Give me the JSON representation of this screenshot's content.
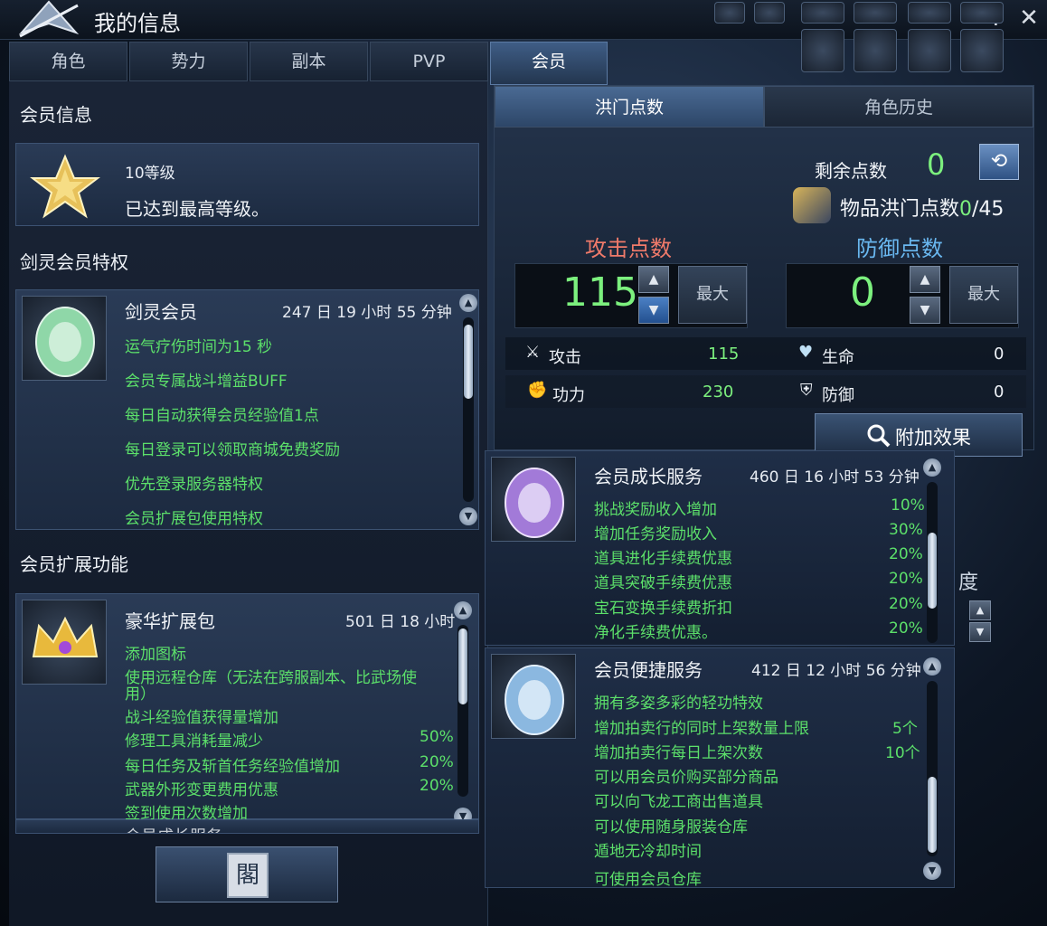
{
  "window": {
    "title": "我的信息",
    "help_icon": "?",
    "close_icon": "✕"
  },
  "tabs": [
    {
      "label": "角色"
    },
    {
      "label": "势力"
    },
    {
      "label": "副本"
    },
    {
      "label": "PVP"
    },
    {
      "label": "会员",
      "active": true
    }
  ],
  "membership": {
    "section_title": "会员信息",
    "level": "10等级",
    "level_status": "已达到最高等级。"
  },
  "privileges": {
    "section_title": "剑灵会员特权",
    "name": "剑灵会员",
    "duration": "247 日 19 小时 55 分钟",
    "items": [
      "运气疗伤时间为15 秒",
      "会员专属战斗增益BUFF",
      "每日自动获得会员经验值1点",
      "每日登录可以领取商城免费奖励",
      "优先登录服务器特权",
      "会员扩展包使用特权"
    ]
  },
  "extensions": {
    "section_title": "会员扩展功能",
    "name": "豪华扩展包",
    "duration": "501 日 18 小时",
    "items": [
      {
        "label": "添加图标",
        "value": ""
      },
      {
        "label": "使用远程仓库（无法在跨服副本、比武场使",
        "value": ""
      },
      {
        "label": "用）",
        "value": ""
      },
      {
        "label": "战斗经验值获得量增加",
        "value": ""
      },
      {
        "label": "修理工具消耗量减少",
        "value": "50%"
      },
      {
        "label": "每日任务及斩首任务经验值增加",
        "value": "20%"
      },
      {
        "label": "武器外形变更费用优惠",
        "value": "20%"
      },
      {
        "label": "签到使用次数增加",
        "value": ""
      }
    ],
    "partial_next": "会员成长服务"
  },
  "points": {
    "subtab_active": "洪门点数",
    "subtab_inactive": "角色历史",
    "remaining_label": "剩余点数",
    "remaining_value": "0",
    "item_points_label": "物品洪门点数",
    "item_points_current": "0",
    "item_points_max": "/45",
    "attack_title": "攻击点数",
    "defense_title": "防御点数",
    "attack_value": "115",
    "defense_value": "0",
    "max_label": "最大",
    "stats": {
      "attack_label": "攻击",
      "attack_value": "115",
      "power_label": "功力",
      "power_value": "230",
      "hp_label": "生命",
      "hp_value": "0",
      "def_label": "防御",
      "def_value": "0"
    },
    "extra_effect_label": "附加效果"
  },
  "growth_service": {
    "name": "会员成长服务",
    "duration": "460 日 16 小时 53 分钟",
    "items": [
      {
        "label": "挑战奖励收入增加",
        "value": "10%"
      },
      {
        "label": "增加任务奖励收入",
        "value": "30%"
      },
      {
        "label": "道具进化手续费优惠",
        "value": "20%"
      },
      {
        "label": "道具突破手续费优惠",
        "value": "20%"
      },
      {
        "label": "宝石变换手续费折扣",
        "value": "20%"
      },
      {
        "label": "净化手续费优惠。",
        "value": "20%"
      }
    ]
  },
  "convenience_service": {
    "name": "会员便捷服务",
    "duration": "412 日 12 小时 56 分钟",
    "items": [
      {
        "label": "拥有多姿多彩的轻功特效",
        "value": ""
      },
      {
        "label": "增加拍卖行的同时上架数量上限",
        "value": "5个"
      },
      {
        "label": "增加拍卖行每日上架次数",
        "value": "10个"
      },
      {
        "label": "可以用会员价购买部分商品",
        "value": ""
      },
      {
        "label": "可以向飞龙工商出售道具",
        "value": ""
      },
      {
        "label": "可以使用随身服装仓库",
        "value": ""
      },
      {
        "label": "遁地无冷却时间",
        "value": ""
      },
      {
        "label": "可使用会员仓库",
        "value": ""
      }
    ]
  },
  "background_fragment": "度",
  "icon_seal_shop": "閣"
}
